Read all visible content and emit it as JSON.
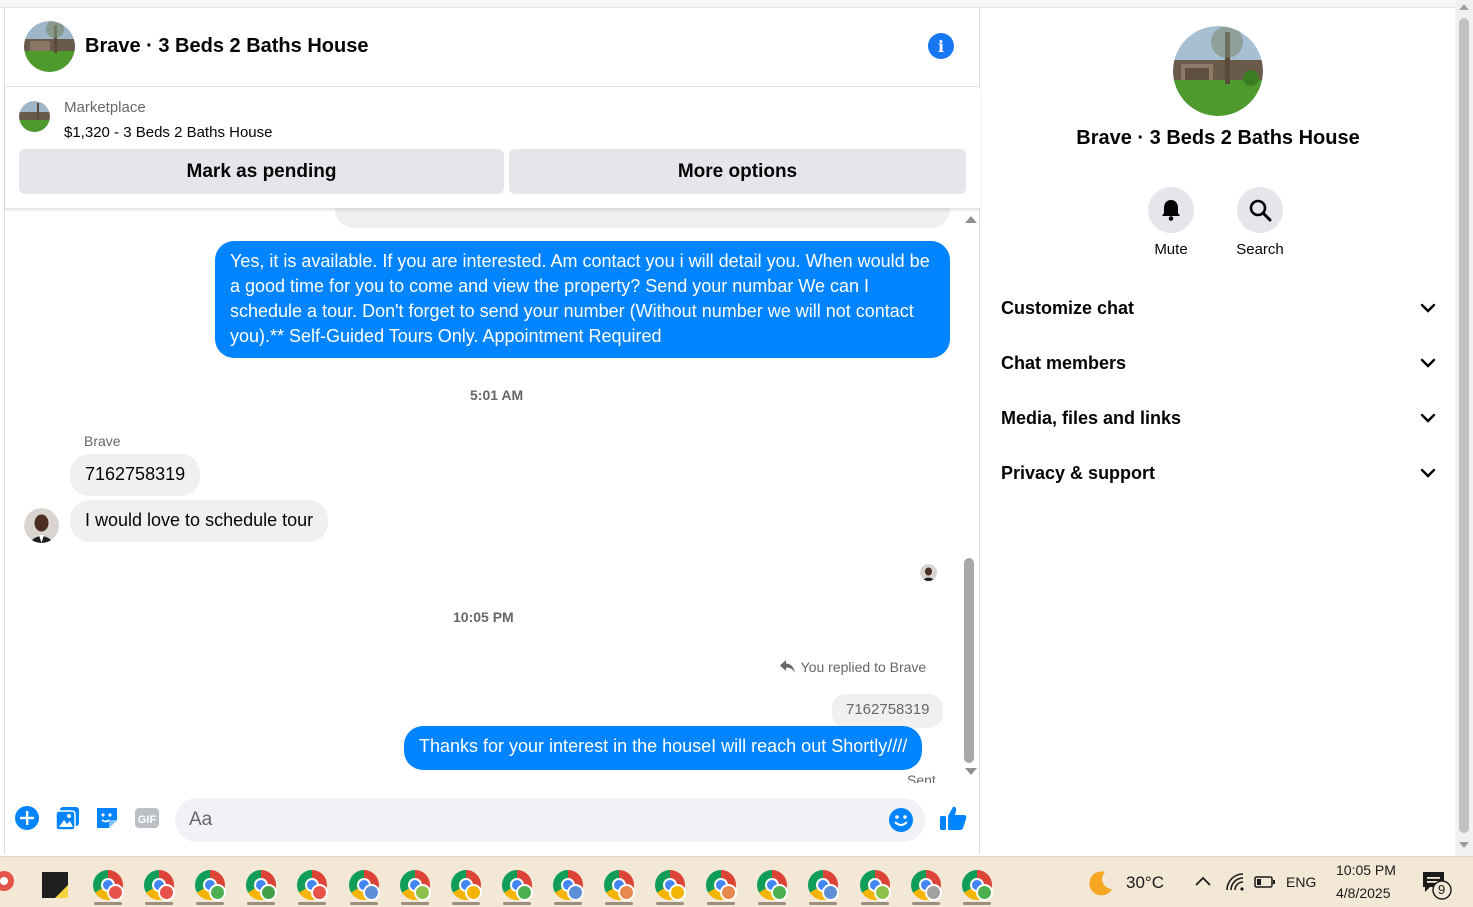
{
  "chat": {
    "title": "Brave · 3 Beds 2 Baths House",
    "listing": {
      "source_label": "Marketplace",
      "title": "$1,320 - 3 Beds 2 Baths House",
      "pending_button": "Mark as pending",
      "more_button": "More options"
    },
    "messages": {
      "outgoing_1": "Yes, it is available. If you are interested.  Am contact you i will detail you.  When would be a good time for you to come and view the property? Send your numbar We can I schedule a tour.  Don't forget to send your number (Without number we will not contact you).** Self-Guided Tours Only. Appointment Required",
      "timestamp_1": "5:01 AM",
      "sender_name": "Brave",
      "incoming_1": "7162758319",
      "incoming_2": "I would love to schedule tour",
      "timestamp_2": "10:05 PM",
      "reply_note": "You replied to Brave",
      "reply_quote": "7162758319",
      "outgoing_2": "Thanks for your interest in the houseI will reach out Shortly////",
      "status": "Sent"
    },
    "composer": {
      "placeholder": "Aa"
    }
  },
  "panel": {
    "title": "Brave · 3 Beds 2 Baths House",
    "actions": [
      {
        "label": "Mute",
        "icon": "bell-icon"
      },
      {
        "label": "Search",
        "icon": "search-icon"
      }
    ],
    "sections": [
      {
        "label": "Customize chat"
      },
      {
        "label": "Chat members"
      },
      {
        "label": "Media, files and links"
      },
      {
        "label": "Privacy & support"
      }
    ]
  },
  "taskbar": {
    "weather": "30°C",
    "language": "ENG",
    "time": "10:05 PM",
    "date": "4/8/2025",
    "notification_count": "9",
    "chrome_profile_colors": [
      "#e5534b",
      "#e5534b",
      "#4caf50",
      "#43a047",
      "#e5534b",
      "#5b8fd6",
      "#8bc34a",
      "#f4b400",
      "#4caf50",
      "#5b8fd6",
      "#e6884b",
      "#f4b400",
      "#e6884b",
      "#4caf50",
      "#5b8fd6",
      "#8bc34a",
      "#a0a0a0",
      "#4caf50"
    ]
  },
  "colors": {
    "messenger_blue": "#0084ff",
    "info_blue": "#1877f2"
  }
}
